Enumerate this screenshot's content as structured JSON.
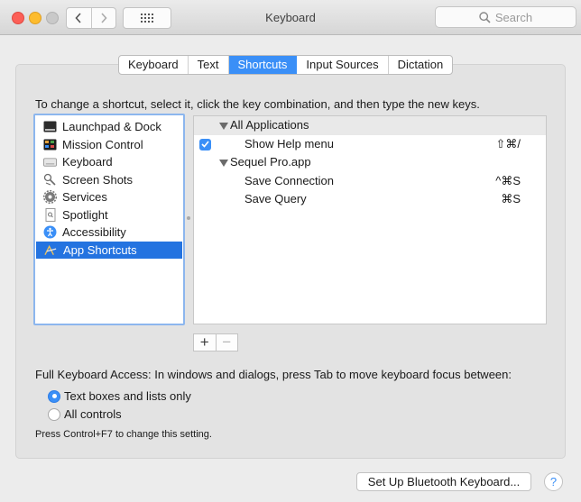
{
  "window": {
    "title": "Keyboard",
    "search_placeholder": "Search"
  },
  "tabs": [
    {
      "label": "Keyboard",
      "selected": false
    },
    {
      "label": "Text",
      "selected": false
    },
    {
      "label": "Shortcuts",
      "selected": true
    },
    {
      "label": "Input Sources",
      "selected": false
    },
    {
      "label": "Dictation",
      "selected": false
    }
  ],
  "instructions": "To change a shortcut, select it, click the key combination, and then type the new keys.",
  "categories": [
    {
      "label": "Launchpad & Dock",
      "icon": "launchpad-dock-icon",
      "selected": false
    },
    {
      "label": "Mission Control",
      "icon": "mission-control-icon",
      "selected": false
    },
    {
      "label": "Keyboard",
      "icon": "keyboard-icon",
      "selected": false
    },
    {
      "label": "Screen Shots",
      "icon": "screenshot-icon",
      "selected": false
    },
    {
      "label": "Services",
      "icon": "gear-icon",
      "selected": false
    },
    {
      "label": "Spotlight",
      "icon": "spotlight-icon",
      "selected": false
    },
    {
      "label": "Accessibility",
      "icon": "accessibility-icon",
      "selected": false
    },
    {
      "label": "App Shortcuts",
      "icon": "app-shortcuts-icon",
      "selected": true
    }
  ],
  "shortcut_groups": [
    {
      "name": "All Applications",
      "shortcuts": [
        {
          "name": "Show Help menu",
          "keys": "⇧⌘/",
          "checked": true
        }
      ]
    },
    {
      "name": "Sequel Pro.app",
      "shortcuts": [
        {
          "name": "Save Connection",
          "keys": "^⌘S"
        },
        {
          "name": "Save Query",
          "keys": "⌘S"
        }
      ]
    }
  ],
  "add_button": "+",
  "remove_button": "−",
  "full_keyboard_access": {
    "label": "Full Keyboard Access: In windows and dialogs, press Tab to move keyboard focus between:",
    "options": [
      {
        "label": "Text boxes and lists only",
        "selected": true
      },
      {
        "label": "All controls",
        "selected": false
      }
    ],
    "hint": "Press Control+F7 to change this setting."
  },
  "bluetooth_button": "Set Up Bluetooth Keyboard...",
  "help_button": "?",
  "colors": {
    "accent": "#3a8ff7",
    "selection": "#2473e0"
  }
}
